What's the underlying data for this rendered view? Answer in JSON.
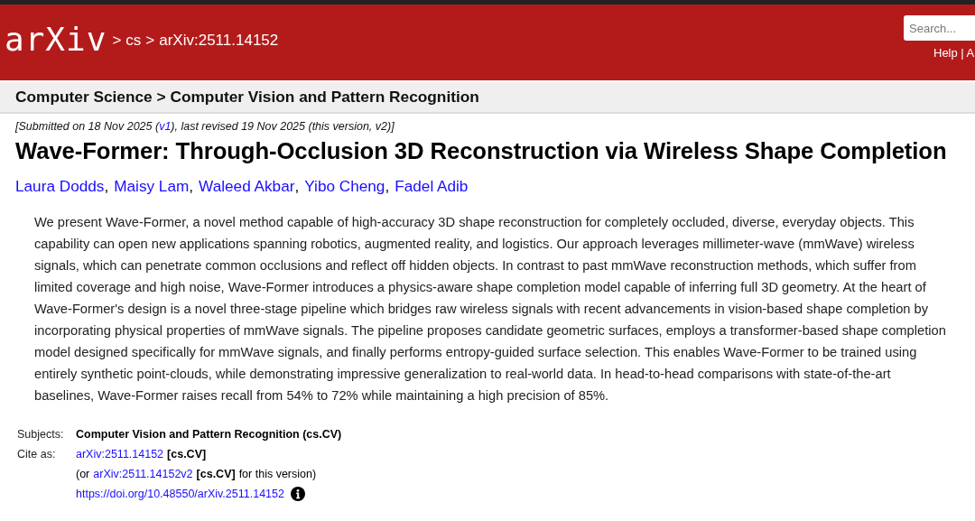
{
  "header": {
    "logo": "arXiv",
    "breadcrumb": [
      ">",
      "cs",
      ">",
      "arXiv:2511.14152"
    ],
    "search": {
      "placeholder": "Search..."
    },
    "links": "Help | A"
  },
  "subheader": "Computer Science > Computer Vision and Pattern Recognition",
  "dateline": [
    {
      "kind": "text",
      "text": "[Submitted on 18 Nov 2025 ("
    },
    {
      "kind": "link",
      "text": "v1"
    },
    {
      "kind": "text",
      "text": "), last revised 19 Nov 2025 (this version, v2)]"
    }
  ],
  "title": "Wave-Former: Through-Occlusion 3D Reconstruction via Wireless Shape Completion",
  "authors": [
    {
      "name": "Laura Dodds",
      "separator": ","
    },
    {
      "name": "Maisy Lam",
      "separator": ","
    },
    {
      "name": "Waleed Akbar",
      "separator": ","
    },
    {
      "name": "Yibo Cheng",
      "separator": ","
    },
    {
      "name": "Fadel Adib"
    }
  ],
  "abstract": "We present Wave-Former, a novel method capable of high-accuracy 3D shape reconstruction for completely occluded, diverse, everyday objects. This capability can open new applications spanning robotics, augmented reality, and logistics. Our approach leverages millimeter-wave (mmWave) wireless signals, which can penetrate common occlusions and reflect off hidden objects. In contrast to past mmWave reconstruction methods, which suffer from limited coverage and high noise, Wave-Former introduces a physics-aware shape completion model capable of inferring full 3D geometry. At the heart of Wave-Former's design is a novel three-stage pipeline which bridges raw wireless signals with recent advancements in vision-based shape completion by incorporating physical properties of mmWave signals. The pipeline proposes candidate geometric surfaces, employs a transformer-based shape completion model designed specifically for mmWave signals, and finally performs entropy-guided surface selection. This enables Wave-Former to be trained using entirely synthetic point-clouds, while demonstrating impressive generalization to real-world data. In head-to-head comparisons with state-of-the-art baselines, Wave-Former raises recall from 54% to 72% while maintaining a high precision of 85%.",
  "metadata": [
    {
      "label": "Subjects:",
      "lines": [
        [
          {
            "kind": "bold",
            "text": "Computer Vision and Pattern Recognition (cs.CV)"
          }
        ]
      ]
    },
    {
      "label": "Cite as:",
      "lines": [
        [
          {
            "kind": "link",
            "text": "arXiv:2511.14152"
          },
          {
            "kind": "bold",
            "text": "[cs.CV]"
          }
        ],
        [
          {
            "kind": "text",
            "text": "(or"
          },
          {
            "kind": "link",
            "text": "arXiv:2511.14152v2"
          },
          {
            "kind": "bold",
            "text": "[cs.CV]"
          },
          {
            "kind": "text",
            "text": "for this version)"
          }
        ],
        [
          {
            "kind": "link",
            "text": "https://doi.org/10.48550/arXiv.2511.14152"
          },
          {
            "kind": "info"
          }
        ]
      ]
    }
  ]
}
